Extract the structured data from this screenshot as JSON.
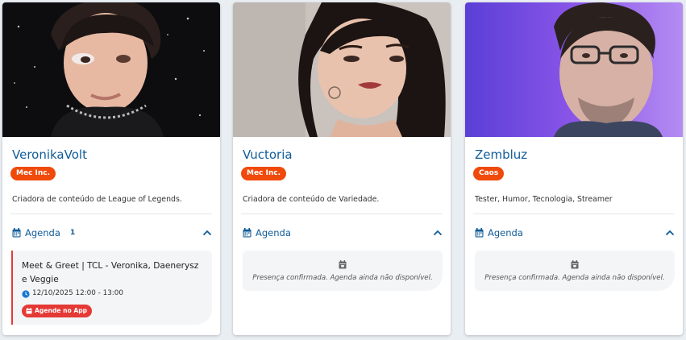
{
  "cards": [
    {
      "name": "VeronikaVolt",
      "tag": "Mec Inc.",
      "description": "Criadora de conteúdo de League of Legends.",
      "agenda_label": "Agenda",
      "agenda_count": "1",
      "event": {
        "title": "Meet & Greet | TCL - Veronika, Daenerysz e Veggie",
        "time": "12/10/2025 12:00 - 13:00",
        "button": "Agende no App"
      }
    },
    {
      "name": "Vuctoria",
      "tag": "Mec Inc.",
      "description": "Criadora de conteúdo de Variedade.",
      "agenda_label": "Agenda",
      "empty_text": "Presença confirmada. Agenda ainda não disponível."
    },
    {
      "name": "Zembluz",
      "tag": "Caos",
      "description": "Tester, Humor, Tecnologia, Streamer",
      "agenda_label": "Agenda",
      "empty_text": "Presença confirmada. Agenda ainda não disponível."
    }
  ],
  "colors": {
    "accent": "#0f5c99",
    "tag": "#f04a0b",
    "event_accent": "#e53935",
    "background": "#e9eef3"
  },
  "icons": [
    "calendar-icon",
    "chevron-up-icon",
    "clock-icon"
  ]
}
